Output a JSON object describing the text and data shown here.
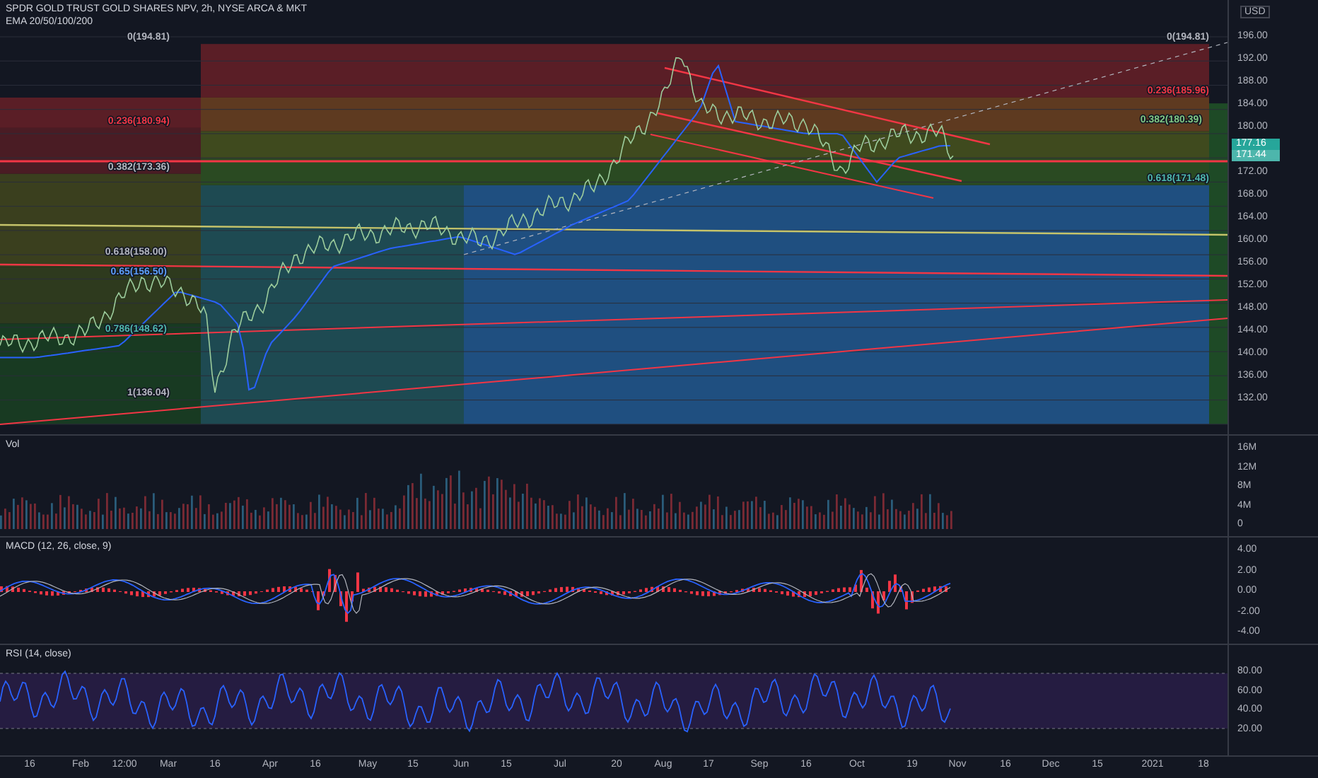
{
  "header": {
    "title": "SPDR GOLD TRUST GOLD SHARES NPV, 2h, NYSE ARCA & MKT",
    "indicator": "EMA 20/50/100/200"
  },
  "price_pane": {
    "currency": "USD",
    "axis": [
      {
        "label": "196.00",
        "kind": "tick"
      },
      {
        "label": "192.00",
        "kind": "tick"
      },
      {
        "label": "188.00",
        "kind": "tick"
      },
      {
        "label": "184.00",
        "kind": "tick"
      },
      {
        "label": "180.00",
        "kind": "tick"
      },
      {
        "label": "177.16",
        "kind": "tag"
      },
      {
        "label": "171.44",
        "kind": "tag"
      },
      {
        "label": "172.00",
        "kind": "tick"
      },
      {
        "label": "168.00",
        "kind": "tick"
      },
      {
        "label": "164.00",
        "kind": "tick"
      },
      {
        "label": "160.00",
        "kind": "tick"
      },
      {
        "label": "156.00",
        "kind": "tick"
      },
      {
        "label": "152.00",
        "kind": "tick"
      },
      {
        "label": "148.00",
        "kind": "tick"
      },
      {
        "label": "144.00",
        "kind": "tick"
      },
      {
        "label": "140.00",
        "kind": "tick"
      },
      {
        "label": "136.00",
        "kind": "tick"
      },
      {
        "label": "132.00",
        "kind": "tick"
      }
    ],
    "fib_labels": [
      {
        "text": "0(194.81)",
        "color": "#b2b5be"
      },
      {
        "text": "0(194.81)",
        "color": "#b2b5be"
      },
      {
        "text": "0.236(185.96)",
        "color": "#f23645"
      },
      {
        "text": "0.236(180.94)",
        "color": "#f23645"
      },
      {
        "text": "0.382(180.39)",
        "color": "#81c784"
      },
      {
        "text": "0.382(173.36)",
        "color": "#b2b5be"
      },
      {
        "text": "0.618(171.48)",
        "color": "#4db6ac"
      },
      {
        "text": "0.618(158.00)",
        "color": "#b2b5be"
      },
      {
        "text": "0.65(156.50)",
        "color": "#5b9cf6"
      },
      {
        "text": "0.786(148.62)",
        "color": "#4db6ac"
      },
      {
        "text": "1(136.04)",
        "color": "#b2b5be"
      }
    ]
  },
  "panes": [
    {
      "title": "Vol",
      "kind": "volume",
      "axis": [
        "16M",
        "12M",
        "8M",
        "4M",
        "0"
      ]
    },
    {
      "title": "MACD (12, 26, close, 9)",
      "kind": "macd",
      "axis": [
        "4.00",
        "2.00",
        "0.00",
        "-2.00",
        "-4.00"
      ]
    },
    {
      "title": "RSI (14, close)",
      "kind": "rsi",
      "axis": [
        "80.00",
        "60.00",
        "40.00",
        "20.00"
      ]
    }
  ],
  "time_axis": [
    "16",
    "Feb",
    "12:00",
    "Mar",
    "16",
    "Apr",
    "16",
    "May",
    "15",
    "Jun",
    "15",
    "Jul",
    "20",
    "Aug",
    "17",
    "Sep",
    "16",
    "Oct",
    "19",
    "Nov",
    "16",
    "Dec",
    "15",
    "2021",
    "18"
  ]
}
